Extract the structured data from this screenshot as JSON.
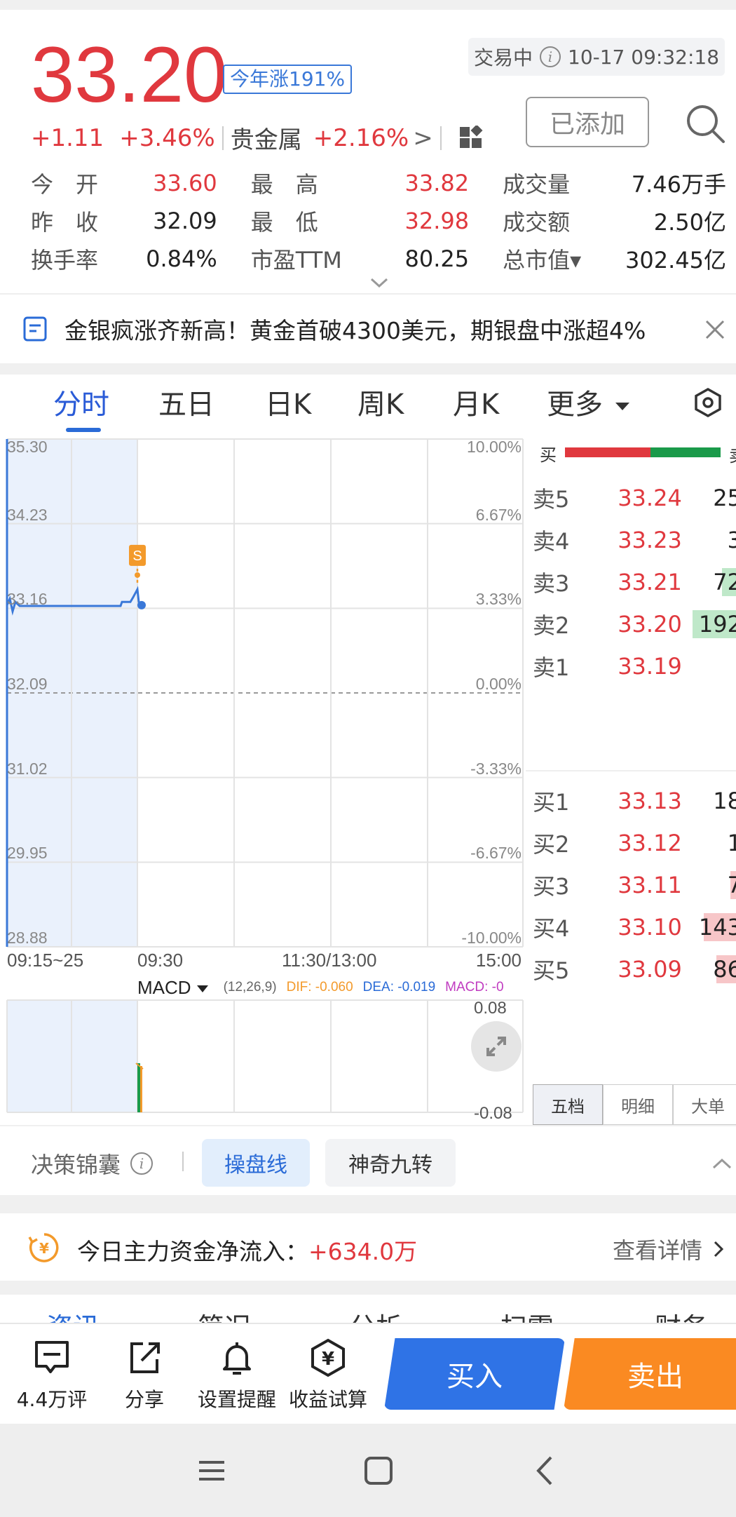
{
  "quote": {
    "price": "33.20",
    "year_change": "今年涨191%",
    "change": "+1.11",
    "change_pct": "+3.46%",
    "sector": "贵金属",
    "sector_change": "+2.16%",
    "sector_arrow": ">",
    "status": "交易中",
    "datetime": "10-17 09:32:18",
    "added_label": "已添加"
  },
  "stats": [
    [
      {
        "label": "今　开",
        "value": "33.60",
        "color": "red"
      },
      {
        "label": "最　高",
        "value": "33.82",
        "color": "red"
      },
      {
        "label": "成交量",
        "value": "7.46万手",
        "color": "dark"
      }
    ],
    [
      {
        "label": "昨　收",
        "value": "32.09",
        "color": "dark"
      },
      {
        "label": "最　低",
        "value": "32.98",
        "color": "red"
      },
      {
        "label": "成交额",
        "value": "2.50亿",
        "color": "dark"
      }
    ],
    [
      {
        "label": "换手率",
        "value": "0.84%",
        "color": "dark"
      },
      {
        "label": "市盈TTM",
        "value": "80.25",
        "color": "dark"
      },
      {
        "label": "总市值▾",
        "value": "302.45亿",
        "color": "dark"
      }
    ]
  ],
  "news": {
    "text": "金银疯涨齐新高！黄金首破4300美元，期银盘中涨超4%"
  },
  "tabs": [
    "分时",
    "五日",
    "日K",
    "周K",
    "月K",
    "更多"
  ],
  "chart": {
    "price_ticks": [
      "35.30",
      "34.23",
      "33.16",
      "32.09",
      "31.02",
      "29.95",
      "28.88"
    ],
    "pct_ticks": [
      "10.00%",
      "6.67%",
      "3.33%",
      "0.00%",
      "-3.33%",
      "-6.67%",
      "-10.00%"
    ],
    "time_labels": [
      "09:15~25",
      "09:30",
      "11:30/13:00",
      "15:00"
    ],
    "signal_label": "S",
    "macd": {
      "name": "MACD",
      "params": "(12,26,9)",
      "dif": "DIF: -0.060",
      "dea": "DEA: -0.019",
      "macd": "MACD: -0",
      "max": "0.08",
      "min": "-0.08"
    },
    "colors": {
      "line": "#3a78d8",
      "up": "#e0383e",
      "down": "#1a9a4a",
      "signal": "#f39a2b"
    }
  },
  "book": {
    "buy_label": "买",
    "sell_label": "卖",
    "buy_ratio": 0.55,
    "asks": [
      {
        "label": "卖5",
        "price": "33.24",
        "volume": "25",
        "fill": 0
      },
      {
        "label": "卖4",
        "price": "33.23",
        "volume": "3",
        "fill": 0
      },
      {
        "label": "卖3",
        "price": "33.21",
        "volume": "72",
        "fill": 0.2
      },
      {
        "label": "卖2",
        "price": "33.20",
        "volume": "192",
        "fill": 0.62
      },
      {
        "label": "卖1",
        "price": "33.19",
        "volume": "",
        "fill": 0
      }
    ],
    "bids": [
      {
        "label": "买1",
        "price": "33.13",
        "volume": "18",
        "fill": 0
      },
      {
        "label": "买2",
        "price": "33.12",
        "volume": "1",
        "fill": 0
      },
      {
        "label": "买3",
        "price": "33.11",
        "volume": "7",
        "fill": 0.08
      },
      {
        "label": "买4",
        "price": "33.10",
        "volume": "143",
        "fill": 0.46
      },
      {
        "label": "买5",
        "price": "33.09",
        "volume": "86",
        "fill": 0.28
      }
    ],
    "tabs": [
      "五档",
      "明细",
      "大单"
    ]
  },
  "decision": {
    "label": "决策锦囊",
    "chips": [
      "操盘线",
      "神奇九转"
    ]
  },
  "flow": {
    "text_prefix": "今日主力资金净流入：",
    "value": "+634.0万",
    "detail": "查看详情"
  },
  "subtabs": [
    "资讯",
    "简况",
    "分析",
    "扫雷",
    "财务"
  ],
  "bottom": {
    "comments": "4.4万评",
    "share": "分享",
    "alert": "设置提醒",
    "calc": "收益试算",
    "buy": "买入",
    "sell": "卖出"
  }
}
